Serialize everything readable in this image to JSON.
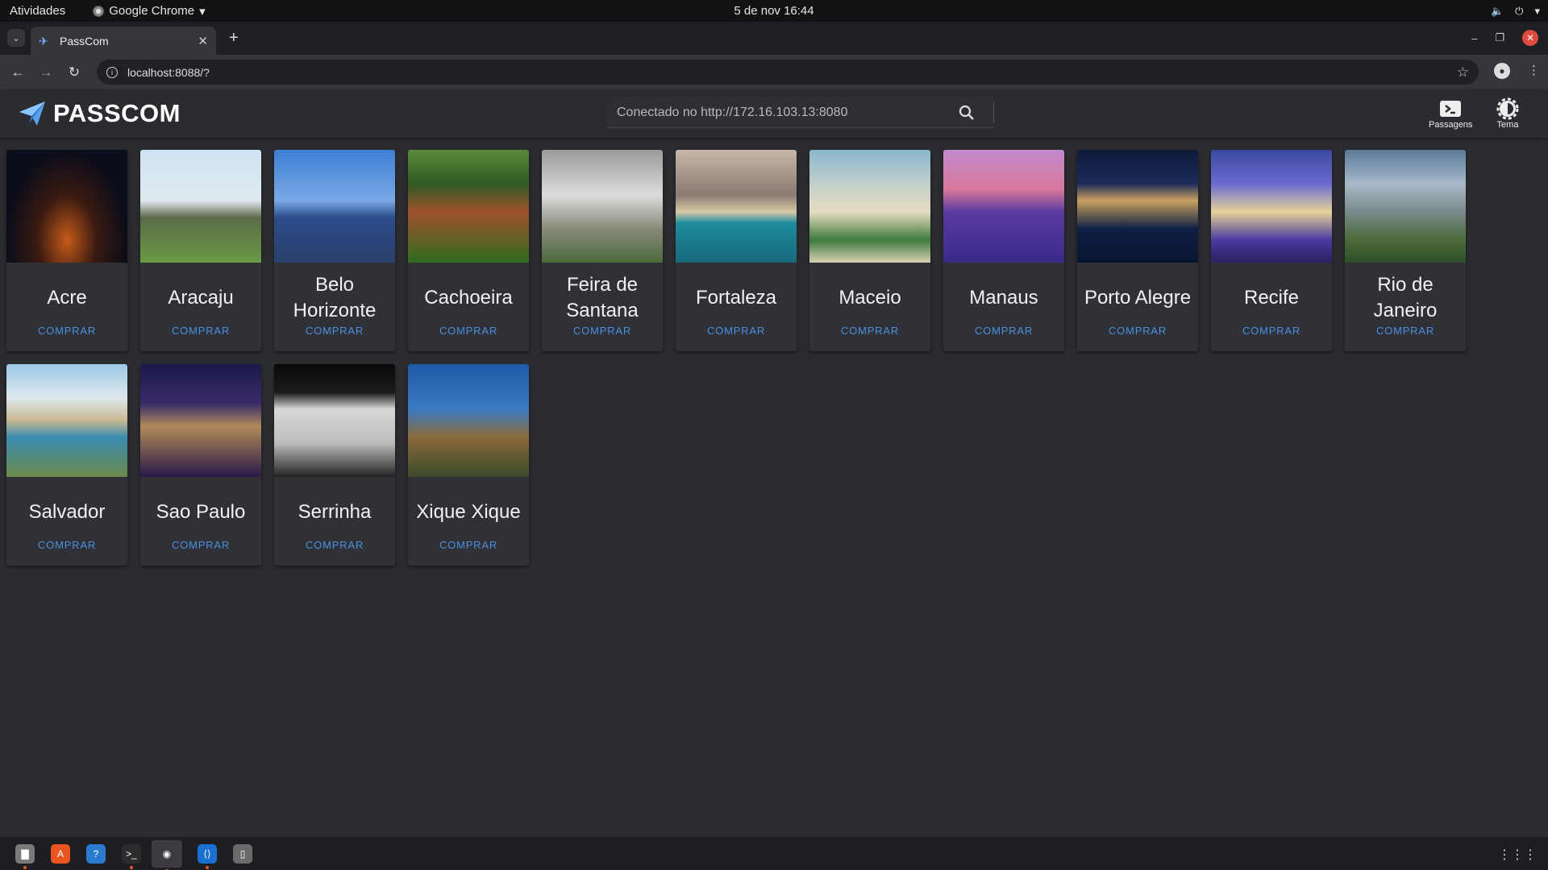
{
  "system_bar": {
    "activities": "Atividades",
    "app_menu": "Google Chrome",
    "datetime": "5 de nov  16:44"
  },
  "browser": {
    "tab_title": "PassCom",
    "url": "localhost:8088/?"
  },
  "app": {
    "brand": "PASSCOM",
    "search_text": "Conectado no http://172.16.103.13:8080",
    "header_buttons": {
      "tickets": "Passagens",
      "theme": "Tema"
    }
  },
  "buy_label": "COMPRAR",
  "cities": [
    {
      "name": "Acre",
      "image": "i-acre"
    },
    {
      "name": "Aracaju",
      "image": "i-aracaju"
    },
    {
      "name": "Belo Horizonte",
      "image": "i-bh"
    },
    {
      "name": "Cachoeira",
      "image": "i-cachoeira"
    },
    {
      "name": "Feira de Santana",
      "image": "i-feira"
    },
    {
      "name": "Fortaleza",
      "image": "i-fortaleza"
    },
    {
      "name": "Maceio",
      "image": "i-maceio"
    },
    {
      "name": "Manaus",
      "image": "i-manaus"
    },
    {
      "name": "Porto Alegre",
      "image": "i-porto"
    },
    {
      "name": "Recife",
      "image": "i-recife"
    },
    {
      "name": "Rio de Janeiro",
      "image": "i-rio"
    },
    {
      "name": "Salvador",
      "image": "i-salvador"
    },
    {
      "name": "Sao Paulo",
      "image": "i-sp"
    },
    {
      "name": "Serrinha",
      "image": "i-serrinha"
    },
    {
      "name": "Xique Xique",
      "image": "i-xique"
    }
  ],
  "dock": [
    {
      "name": "files",
      "icon": "folder-icon"
    },
    {
      "name": "software",
      "icon": "app-store-icon"
    },
    {
      "name": "help",
      "icon": "help-icon"
    },
    {
      "name": "terminal",
      "icon": "terminal-icon"
    },
    {
      "name": "chrome",
      "icon": "chrome-icon",
      "active": true
    },
    {
      "name": "vscode",
      "icon": "vscode-icon"
    },
    {
      "name": "trash",
      "icon": "trash-icon"
    }
  ],
  "colors": {
    "accent": "#4a8fe0",
    "card_bg": "#303136",
    "page_bg": "#2b2c30"
  }
}
